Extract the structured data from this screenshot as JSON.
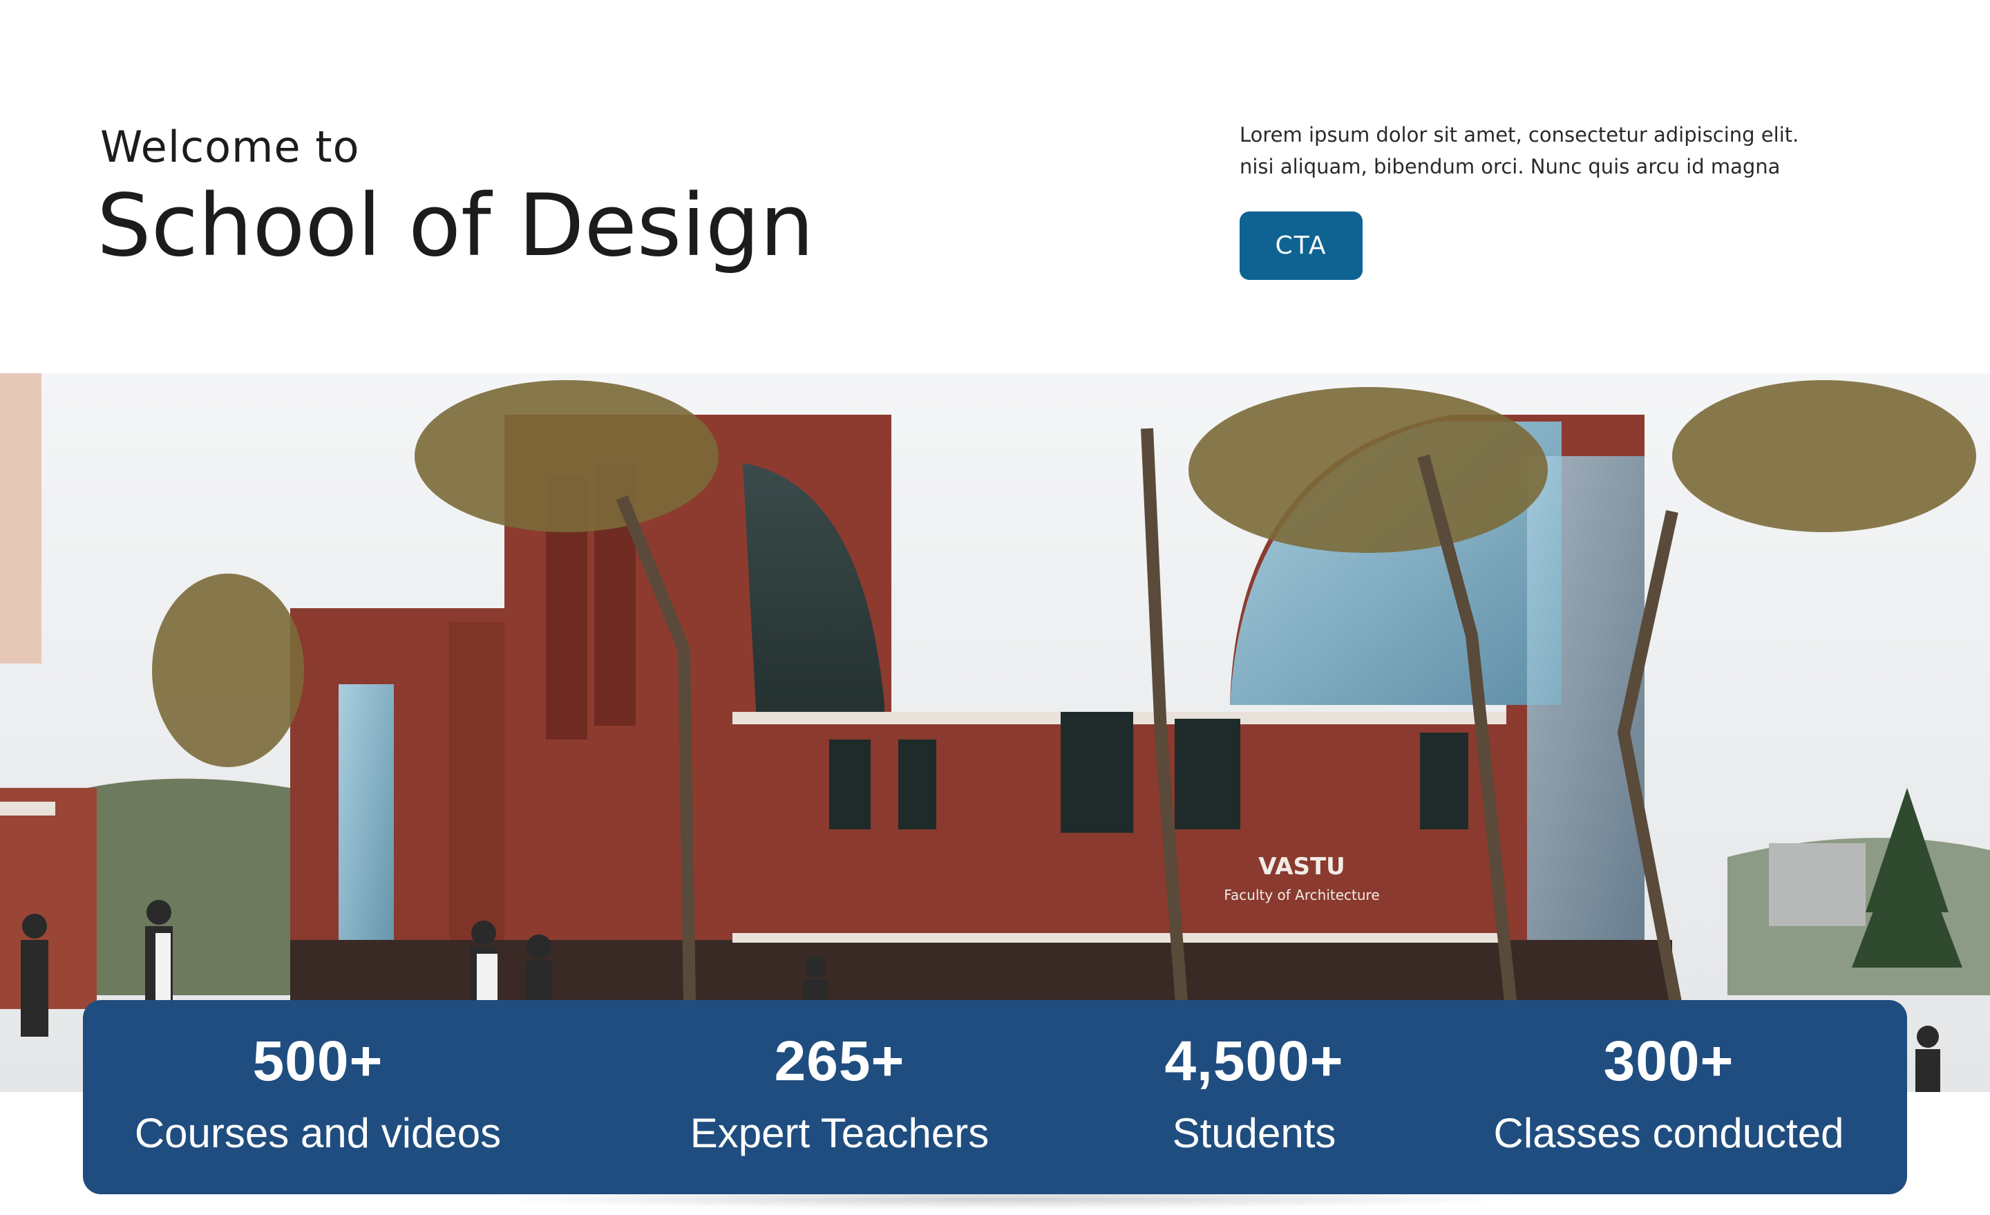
{
  "hero": {
    "welcome": "Welcome to",
    "title": "School of Design",
    "intro_line1": "Lorem ipsum dolor sit amet, consectetur adipiscing elit.",
    "intro_line2": "nisi aliquam, bibendum orci. Nunc quis arcu id magna",
    "cta_label": "CTA"
  },
  "photo": {
    "sign_line1": "VASTU",
    "sign_line2": "Faculty of Architecture"
  },
  "stats": [
    {
      "value": "500+",
      "label": "Courses and videos"
    },
    {
      "value": "265+",
      "label": "Expert Teachers"
    },
    {
      "value": "4,500+",
      "label": "Students"
    },
    {
      "value": "300+",
      "label": "Classes conducted"
    }
  ],
  "colors": {
    "cta": "#0e6392",
    "stats_bg": "#204d7f",
    "brick": "#8a3a2e"
  }
}
